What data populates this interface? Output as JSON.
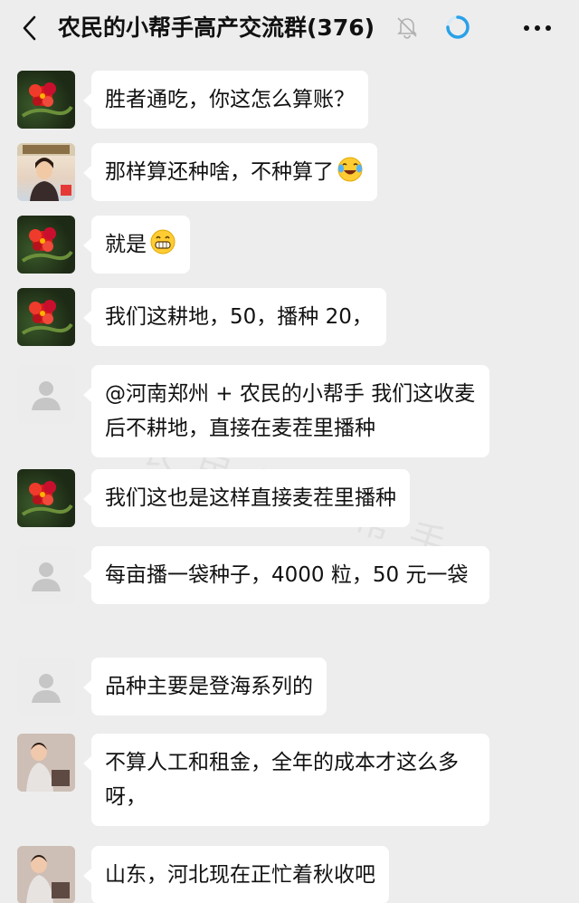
{
  "header": {
    "title": "农民的小帮手高产交流群(376)",
    "back_icon": "chevron-left-icon",
    "mute_icon": "bell-off-icon",
    "status_icon": "loading-ring-icon",
    "more_icon": "more-horizontal-icon"
  },
  "colors": {
    "background": "#ededed",
    "bubble": "#ffffff",
    "ring": "#2aa1e8"
  },
  "watermark": "农民的小帮手",
  "messages": [
    {
      "avatar": "flower-avatar",
      "text": "胜者通吃，你这怎么算账？"
    },
    {
      "avatar": "woman-avatar",
      "text": "那样算还种啥，不种算了",
      "emoji": "laugh-cry-emoji"
    },
    {
      "avatar": "flower-avatar",
      "text": "就是",
      "emoji": "grin-emoji"
    },
    {
      "avatar": "flower-avatar",
      "text": "我们这耕地，50，播种 20，"
    },
    {
      "avatar": "default-avatar",
      "text": "@河南郑州 + 农民的小帮手  我们这收麦后不耕地，直接在麦茬里播种"
    },
    {
      "avatar": "flower-avatar",
      "text": "我们这也是这样直接麦茬里播种"
    },
    {
      "avatar": "default-avatar",
      "text": "每亩播一袋种子，4000 粒，50 元一袋"
    },
    {
      "avatar": "default-avatar",
      "text": "品种主要是登海系列的"
    },
    {
      "avatar": "child-avatar",
      "text": "不算人工和租金，全年的成本才这么多呀，"
    },
    {
      "avatar": "child-avatar",
      "text": "山东，河北现在正忙着秋收吧"
    }
  ]
}
